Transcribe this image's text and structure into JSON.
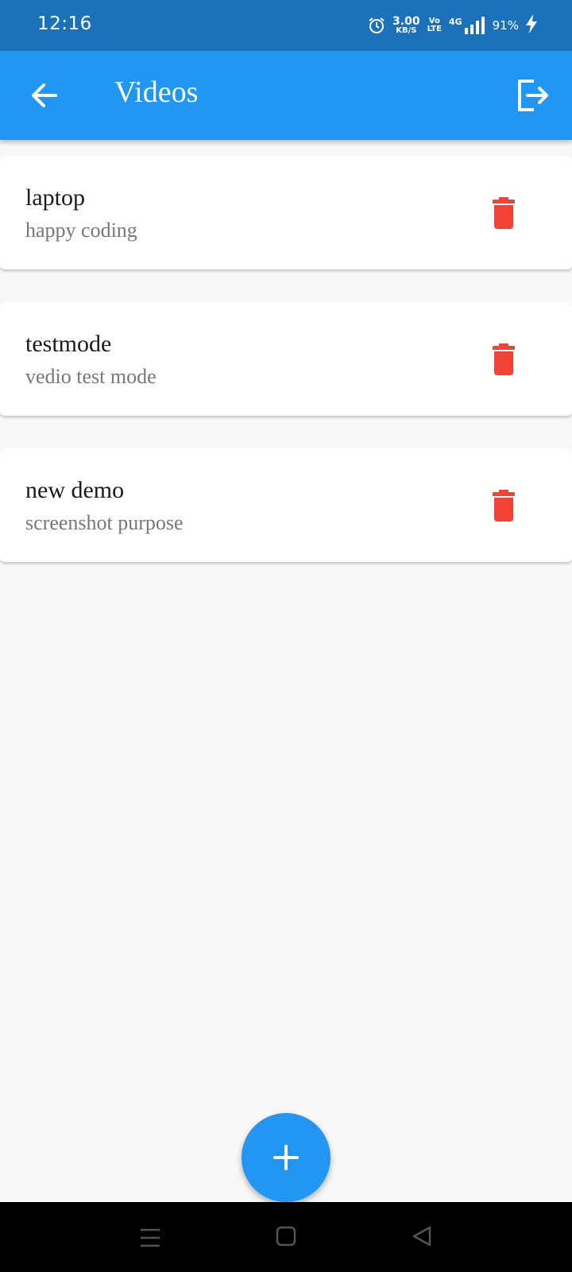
{
  "status_bar": {
    "time": "12:16",
    "net_speed_value": "3.00",
    "net_speed_unit": "KB/S",
    "volte_top": "Vo",
    "volte_bottom": "LTE",
    "network_type": "4G",
    "battery": "91%",
    "icons": [
      "alarm-icon",
      "signal-icon",
      "charging-icon"
    ]
  },
  "app_bar": {
    "title": "Videos",
    "back_icon": "arrow-back-icon",
    "logout_icon": "logout-icon",
    "color": "#2196f3"
  },
  "videos": [
    {
      "title": "laptop",
      "subtitle": "happy coding",
      "action_icon": "delete-icon"
    },
    {
      "title": "testmode",
      "subtitle": "vedio test mode",
      "action_icon": "delete-icon"
    },
    {
      "title": "new demo",
      "subtitle": "screenshot purpose",
      "action_icon": "delete-icon"
    }
  ],
  "fab": {
    "icon": "add-icon",
    "color": "#2196f3"
  },
  "nav_bar": {
    "icons": [
      "menu-icon",
      "home-icon",
      "back-icon"
    ]
  },
  "colors": {
    "status_bar": "#1c71bb",
    "delete": "#f44336",
    "background": "#f8f8f8"
  }
}
